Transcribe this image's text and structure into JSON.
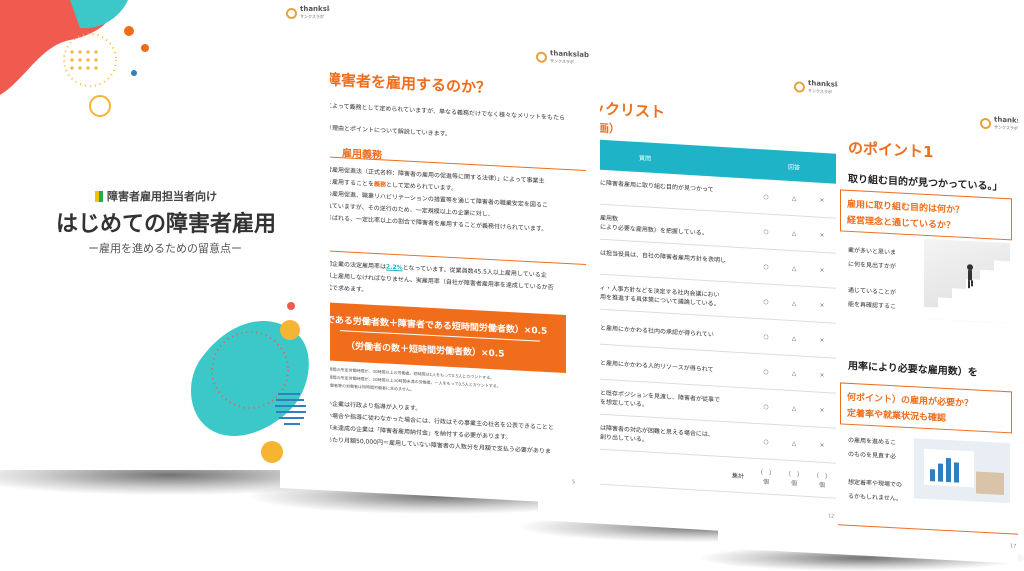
{
  "logo": {
    "name": "thankslab",
    "sub": "サンクスラボ"
  },
  "cover": {
    "tag": "障害者雇用担当者向け",
    "title": "はじめての障害者雇用",
    "subtitle": "ー雇用を進めるための留意点ー"
  },
  "page2": {
    "heading": "障害者を雇用するのか？",
    "intro1": "によって義務として定められていますが、単なる義務だけでなく様々なメリットをもたら",
    "intro2": "き理由とポイントについて解説していきます。",
    "section": "雇用義務",
    "body1": "者雇用促進法（正式名称：障害者の雇用の促進等に関する法律）」によって事業主",
    "body2": "を雇用することを",
    "body2_em": "義務",
    "body2_end": "として定められています。",
    "body3": "の雇用促進、職業リハビリテーションの措置等を通じて障害者の職業安定を図るこ",
    "body4": "れていますが、その逆行のため、一定規模以上の企業に対し、",
    "body5": "まばれる、一定比率以上の割合で障害者を雇用することが義務付けられています。",
    "rate1": "間企業の法定雇用率は",
    "rate_em": "2.2%",
    "rate1_end": "となっています。従業員数45.5人以上雇用している企",
    "rate2": "以上雇用しなければなりません。実雇用率（自社が障害者雇用率を達成しているか否",
    "rate3": "式で求めます。",
    "formula_top": "である労働者数＋障害者である短時間労働者数）×0.5",
    "formula_bottom": "（労働者の数＋短時間労働者数）×0.5",
    "note1": "1週間の所定労働時間が、30時間以上の労働者。短時間は1人をもって0.5人とカウントする。",
    "note2": "1週間の所定労働時間が、20時間以上30時間未満の労働者。一人をもって0.5人とカウントする。",
    "note3": "労働者等の労働者は短時間労働者に含めません。",
    "body6": "い企業は行政より指導が入ります。",
    "body7": "い場合や指導に従わなかった場合には、行政はその事業主の社名を公表できることと",
    "body8": "率未達成の企業は「障害者雇用納付金」を納付する必要があります。",
    "body9": "あたり月額50,000円＝雇用していない障害者の人数分を月額で支払う必要がありま",
    "page_num": "5"
  },
  "page3": {
    "heading": "チェックリスト",
    "sub": "の計画）",
    "col_q": "質問",
    "col_a": "回答",
    "rows": [
      {
        "q1": "が持続的に障害者雇用に取り組む目的が見つかって",
        "q2": "。"
      },
      {
        "q1": "の障害者雇用数",
        "q2": "定雇用率により必要な雇用数）を把握している。"
      },
      {
        "q1": "者もしくは担当役員は、自社の障害者雇用方針を表明し",
        "q2": "。"
      },
      {
        "q1": "バーシティ・人事方針などを決定する社内会議におい",
        "q2": "障害者雇用を推進する具体策について議論している。"
      },
      {
        "q1": "者の採用と雇用にかかわる社内の承認が得られてい",
        "q2": ""
      },
      {
        "q1": "者の採用と雇用にかかわる人的リソースが得られて",
        "q2": ""
      },
      {
        "q1": "の各事業と既存ポジションを見渡し、障害者が従事で",
        "q2": "うな職務を想定している。"
      },
      {
        "q1": "の職務では障害者の対応が困難と思える場合には、",
        "q2": "な職務を創り出している。"
      }
    ],
    "mark_a": "○",
    "mark_b": "△",
    "mark_c": "×",
    "total_label": "集計",
    "total_cell": "（　）個",
    "page_num": "12"
  },
  "page4": {
    "heading": "のポイント1",
    "quote": "取り組む目的が見つかっている。」",
    "q1_line1": "雇用に取り組む目的は何か？",
    "q1_line2": "経営理念と通じているか？",
    "text1": "業が多いと思いま",
    "text2": "に何を見出すかが",
    "text3": "通じていることが",
    "text4": "能を再確認するこ",
    "mid": "用率により必要な雇用数）を",
    "q2_line1": "何ポイント）の雇用が必要か？",
    "q2_line2": "定着率や就業状況も確認",
    "text5": "の雇用を進めるこ",
    "text6": "のものを見直す必",
    "text7": "想定着率や現場での",
    "text8": "るかもしれません。",
    "page_num": "17"
  },
  "colors": {
    "accent": "#f06d1c",
    "teal": "#1fb3c8",
    "gold": "#e9a23b"
  }
}
